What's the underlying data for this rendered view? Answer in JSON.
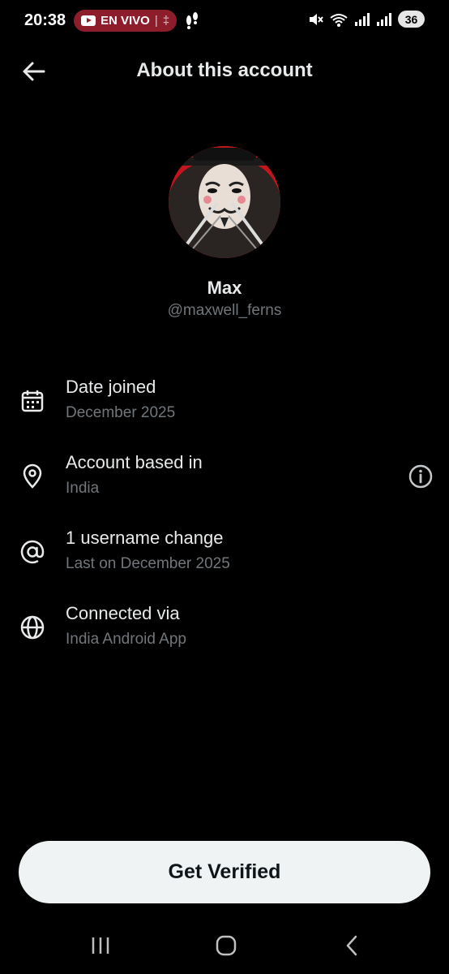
{
  "status_bar": {
    "time": "20:38",
    "live_label": "EN VIVO",
    "live_separator": "|",
    "live_suffix": "‡",
    "battery": "36"
  },
  "header": {
    "title": "About this account"
  },
  "profile": {
    "name": "Max",
    "handle": "@maxwell_ferns"
  },
  "info_rows": [
    {
      "icon": "calendar-icon",
      "title": "Date joined",
      "subtitle": "December 2025"
    },
    {
      "icon": "location-pin-icon",
      "title": "Account based in",
      "subtitle": "India"
    },
    {
      "icon": "at-sign-icon",
      "title": "1 username change",
      "subtitle": "Last on December 2025"
    },
    {
      "icon": "globe-icon",
      "title": "Connected via",
      "subtitle": "India Android App"
    }
  ],
  "verify_button": {
    "label": "Get Verified"
  },
  "colors": {
    "background": "#000000",
    "primary_text": "#e7e9ea",
    "secondary_text": "#71767b",
    "button_bg": "#eff3f4",
    "live_pill": "#8e1d2c"
  }
}
